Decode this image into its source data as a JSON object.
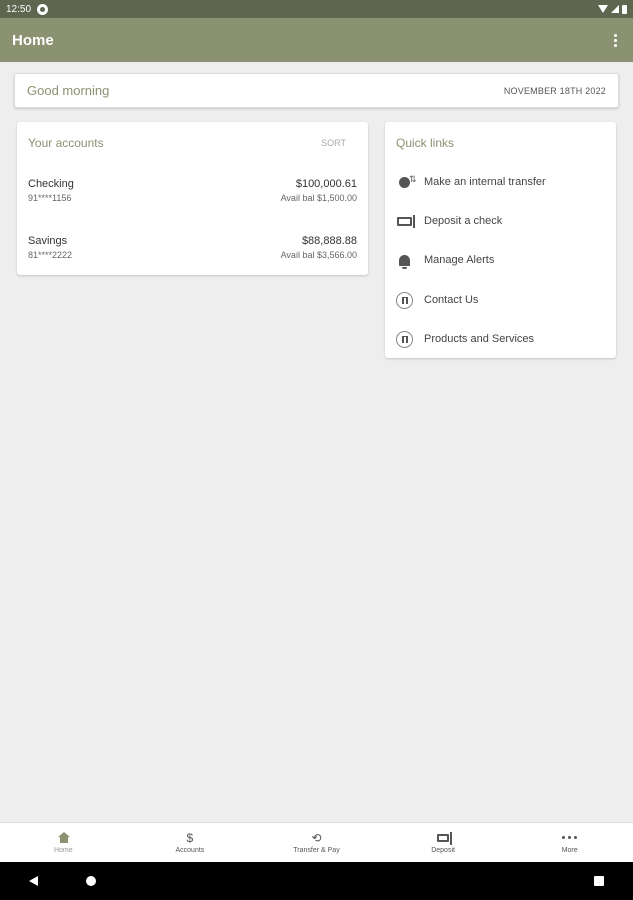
{
  "status_bar": {
    "time": "12:50"
  },
  "app_bar": {
    "title": "Home"
  },
  "greeting": {
    "text": "Good morning",
    "date": "NOVEMBER 18TH 2022"
  },
  "accounts_card": {
    "title": "Your accounts",
    "sort_label": "SORT",
    "accounts": [
      {
        "name": "Checking",
        "number": "91****1156",
        "balance": "$100,000.61",
        "available": "Avail bal $1,500.00"
      },
      {
        "name": "Savings",
        "number": "81****2222",
        "balance": "$88,888.88",
        "available": "Avail bal $3,566.00"
      }
    ]
  },
  "quick_links": {
    "title": "Quick links",
    "items": [
      {
        "label": "Make an internal transfer",
        "icon": "transfer-icon"
      },
      {
        "label": "Deposit a check",
        "icon": "check-deposit-icon"
      },
      {
        "label": "Manage Alerts",
        "icon": "bell-icon"
      },
      {
        "label": "Contact Us",
        "icon": "link-icon"
      },
      {
        "label": "Products and Services",
        "icon": "link-icon"
      }
    ]
  },
  "bottom_nav": {
    "items": [
      {
        "label": "Home",
        "icon": "home-icon",
        "active": true
      },
      {
        "label": "Accounts",
        "icon": "dollar-icon"
      },
      {
        "label": "Transfer & Pay",
        "icon": "transfer-pay-icon"
      },
      {
        "label": "Deposit",
        "icon": "deposit-icon"
      },
      {
        "label": "More",
        "icon": "more-dots-icon"
      }
    ]
  },
  "colors": {
    "status_bar": "#5e6650",
    "app_bar": "#8a9272",
    "accent_text": "#8a9272",
    "background": "#eeeeee"
  }
}
